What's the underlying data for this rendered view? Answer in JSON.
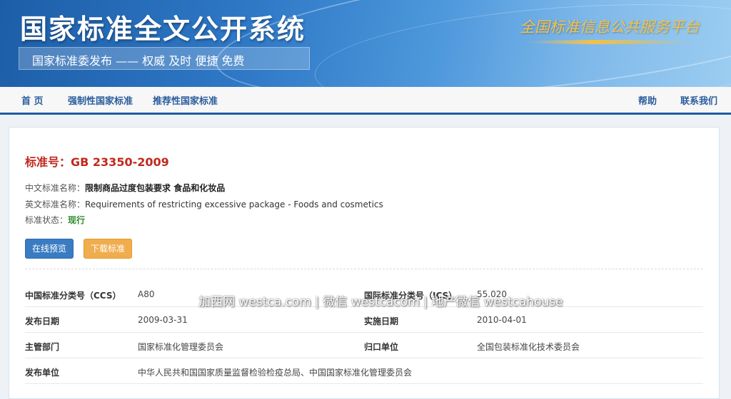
{
  "banner": {
    "site_title": "国家标准全文公开系统",
    "slogan": "国家标准委发布 —— 权威 及时 便捷 免费",
    "platform_label": "全国标准信息公共服务平台",
    "colors": {
      "banner_start": "#1d5ea8",
      "banner_end": "#9ccdf1",
      "platform_gold": "#f3c14a"
    }
  },
  "nav": {
    "home": "首 页",
    "mandatory": "强制性国家标准",
    "recommended": "推荐性国家标准",
    "help": "帮助",
    "contact": "联系我们",
    "accent_color": "#1e5aa6"
  },
  "standard": {
    "number_label": "标准号：",
    "number": "GB 23350-2009",
    "cn_name_label": "中文标准名称：",
    "cn_name": "限制商品过度包装要求 食品和化妆品",
    "en_name_label": "英文标准名称：",
    "en_name": "Requirements of restricting excessive package - Foods and cosmetics",
    "status_label": "标准状态：",
    "status": "现行",
    "number_color": "#c0281e",
    "status_color": "#2e8b2e"
  },
  "buttons": {
    "preview": "在线预览",
    "download": "下载标准"
  },
  "details": {
    "ccs_label": "中国标准分类号（CCS）",
    "ccs_value": "A80",
    "ics_label": "国际标准分类号（ICS）",
    "ics_value": "55.020",
    "publish_label": "发布日期",
    "publish_value": "2009-03-31",
    "impl_label": "实施日期",
    "impl_value": "2010-04-01",
    "authority_label": "主管部门",
    "authority_value": "国家标准化管理委员会",
    "owner_label": "归口单位",
    "owner_value": "全国包装标准化技术委员会",
    "issuer_label": "发布单位",
    "issuer_value": "中华人民共和国国家质量监督检验检疫总局、中国国家标准化管理委员会"
  },
  "watermark": "加西网 westca.com | 微信 westcacom | 地产微信 westcahouse"
}
